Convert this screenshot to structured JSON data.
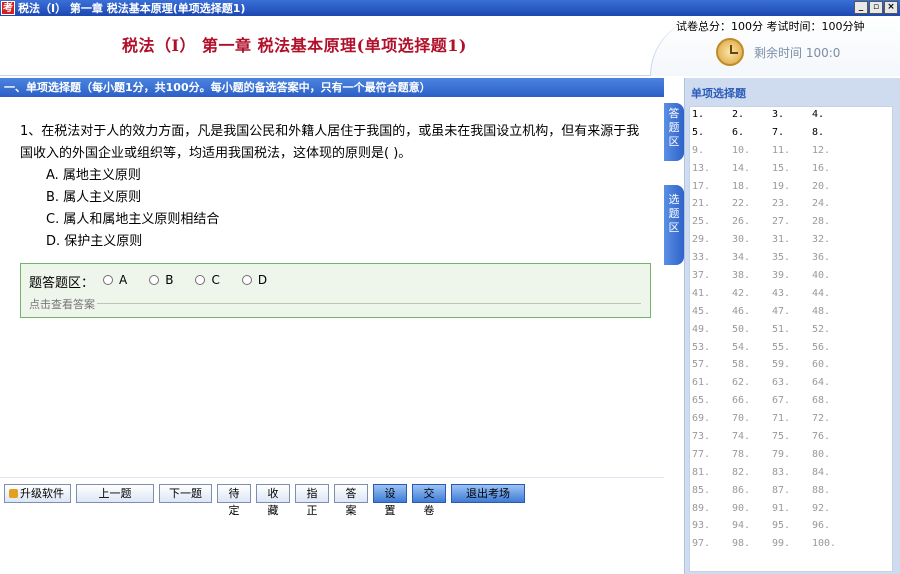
{
  "window": {
    "title": "税法（Ⅰ） 第一章 税法基本原理(单项选择题1)",
    "app_icon": "考",
    "controls": [
      "_",
      "▫",
      "×"
    ]
  },
  "header": {
    "title": "税法（Ⅰ） 第一章 税法基本原理(单项选择题1)",
    "score_info": "试卷总分：100分  考试时间：100分钟",
    "remaining_time": "剩余时间 100:0"
  },
  "section": {
    "heading": "一、单项选择题（每小题1分，共100分。每小题的备选答案中，只有一个最符合题意）"
  },
  "question": {
    "text": "1、在税法对于人的效力方面，凡是我国公民和外籍人居住于我国的，或虽未在我国设立机构，但有来源于我国收入的外国企业或组织等，均适用我国税法，这体现的原则是(    )。",
    "options": [
      "A. 属地主义原则",
      "B. 属人主义原则",
      "C. 属人和属地主义原则相结合",
      "D. 保护主义原则"
    ]
  },
  "answer_area": {
    "label": "题答题区：",
    "choices": [
      "A",
      "B",
      "C",
      "D"
    ],
    "view_answer": "点击查看答案"
  },
  "side_tabs": {
    "answer_tab": "答题区",
    "select_tab": "选题区"
  },
  "right_panel": {
    "title": "单项选择题",
    "numbers": [
      "1.",
      "2.",
      "3.",
      "4.",
      "5.",
      "6.",
      "7.",
      "8.",
      "9.",
      "10.",
      "11.",
      "12.",
      "13.",
      "14.",
      "15.",
      "16.",
      "17.",
      "18.",
      "19.",
      "20.",
      "21.",
      "22.",
      "23.",
      "24.",
      "25.",
      "26.",
      "27.",
      "28.",
      "29.",
      "30.",
      "31.",
      "32.",
      "33.",
      "34.",
      "35.",
      "36.",
      "37.",
      "38.",
      "39.",
      "40.",
      "41.",
      "42.",
      "43.",
      "44.",
      "45.",
      "46.",
      "47.",
      "48.",
      "49.",
      "50.",
      "51.",
      "52.",
      "53.",
      "54.",
      "55.",
      "56.",
      "57.",
      "58.",
      "59.",
      "60.",
      "61.",
      "62.",
      "63.",
      "64.",
      "65.",
      "66.",
      "67.",
      "68.",
      "69.",
      "70.",
      "71.",
      "72.",
      "73.",
      "74.",
      "75.",
      "76.",
      "77.",
      "78.",
      "79.",
      "80.",
      "81.",
      "82.",
      "83.",
      "84.",
      "85.",
      "86.",
      "87.",
      "88.",
      "89.",
      "90.",
      "91.",
      "92.",
      "93.",
      "94.",
      "95.",
      "96.",
      "97.",
      "98.",
      "99.",
      "100."
    ],
    "highlighted_count": 8
  },
  "toolbar": {
    "upgrade": "升级软件",
    "prev": "上一题",
    "next": "下一题",
    "pending": "待定",
    "favorite": "收藏",
    "correct": "指正",
    "answer": "答案",
    "settings": "设置",
    "submit": "交卷",
    "exit": "退出考场"
  }
}
